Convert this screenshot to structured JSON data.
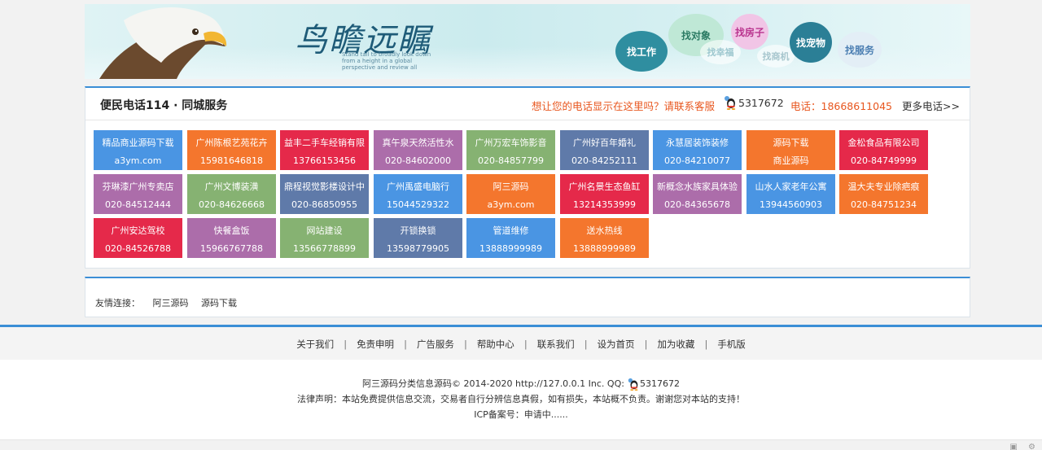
{
  "banner": {
    "logo_text": "鸟瞻远瞩",
    "logo_sub": "Stand tall to broadly look down from a height in a global perspective and review all",
    "bubbles": {
      "job": "找工作",
      "date": "找对象",
      "house": "找房子",
      "pet": "找宠物",
      "service": "找服务",
      "luck": "找幸福",
      "business": "找商机"
    }
  },
  "panel": {
    "title": "便民电话114 · 同城服务",
    "ad_text": "想让您的电话显示在这里吗？请联系客服",
    "qq": "5317672",
    "tel": "电话：18668611045",
    "more": "更多电话>>",
    "tiles": [
      {
        "name": "精品商业源码下载",
        "phone": "a3ym.com",
        "color": "#4a95e3"
      },
      {
        "name": "广州陈根艺苑花卉",
        "phone": "15981646818",
        "color": "#f4762d"
      },
      {
        "name": "益丰二手车经销有限",
        "phone": "13766153456",
        "color": "#e5294a"
      },
      {
        "name": "真午泉天然活性水",
        "phone": "020-84602000",
        "color": "#ac6daa"
      },
      {
        "name": "广州万宏车饰影音",
        "phone": "020-84857799",
        "color": "#86b272"
      },
      {
        "name": "广州好百年婚礼",
        "phone": "020-84252111",
        "color": "#5f7aa9"
      },
      {
        "name": "永慧居装饰装修",
        "phone": "020-84210077",
        "color": "#4a95e3"
      },
      {
        "name": "源码下载",
        "phone": "商业源码",
        "color": "#f4762d"
      },
      {
        "name": "金松食品有限公司",
        "phone": "020-84749999",
        "color": "#e5294a"
      },
      {
        "name": "芬琳漆广州专卖店",
        "phone": "020-84512444",
        "color": "#ac6daa"
      },
      {
        "name": "广州文博装潢",
        "phone": "020-84626668",
        "color": "#86b272"
      },
      {
        "name": "鼎程视觉影楼设计中",
        "phone": "020-86850955",
        "color": "#5f7aa9"
      },
      {
        "name": "广州禹盛电脑行",
        "phone": "15044529322",
        "color": "#4a95e3"
      },
      {
        "name": "阿三源码",
        "phone": "a3ym.com",
        "color": "#f4762d"
      },
      {
        "name": "广州名景生态鱼缸",
        "phone": "13214353999",
        "color": "#e5294a"
      },
      {
        "name": "新概念水族家具体验",
        "phone": "020-84365678",
        "color": "#ac6daa"
      },
      {
        "name": "山水人家老年公寓",
        "phone": "13944560903",
        "color": "#4a95e3"
      },
      {
        "name": "温大夫专业除疤痕",
        "phone": "020-84751234",
        "color": "#f4762d"
      },
      {
        "name": "广州安达驾校",
        "phone": "020-84526788",
        "color": "#e5294a"
      },
      {
        "name": "快餐盒饭",
        "phone": "15966767788",
        "color": "#ac6daa"
      },
      {
        "name": "网站建设",
        "phone": "13566778899",
        "color": "#86b272"
      },
      {
        "name": "开锁换锁",
        "phone": "13598779905",
        "color": "#5f7aa9"
      },
      {
        "name": "管道维修",
        "phone": "13888999989",
        "color": "#4a95e3"
      },
      {
        "name": "送水热线",
        "phone": "13888999989",
        "color": "#f4762d"
      }
    ]
  },
  "links": {
    "label": "友情连接：",
    "items": [
      "阿三源码",
      "源码下载"
    ]
  },
  "footer": {
    "nav": [
      "关于我们",
      "免责申明",
      "广告服务",
      "帮助中心",
      "联系我们",
      "设为首页",
      "加为收藏",
      "手机版"
    ],
    "separator": "|",
    "copyright": "阿三源码分类信息源码© 2014-2020 http://127.0.0.1 Inc. QQ:",
    "qq": "5317672",
    "legal": "法律声明：本站免费提供信息交流，交易者自行分辨信息真假，如有损失，本站概不负责。谢谢您对本站的支持！",
    "icp": "ICP备案号：申请中......"
  }
}
